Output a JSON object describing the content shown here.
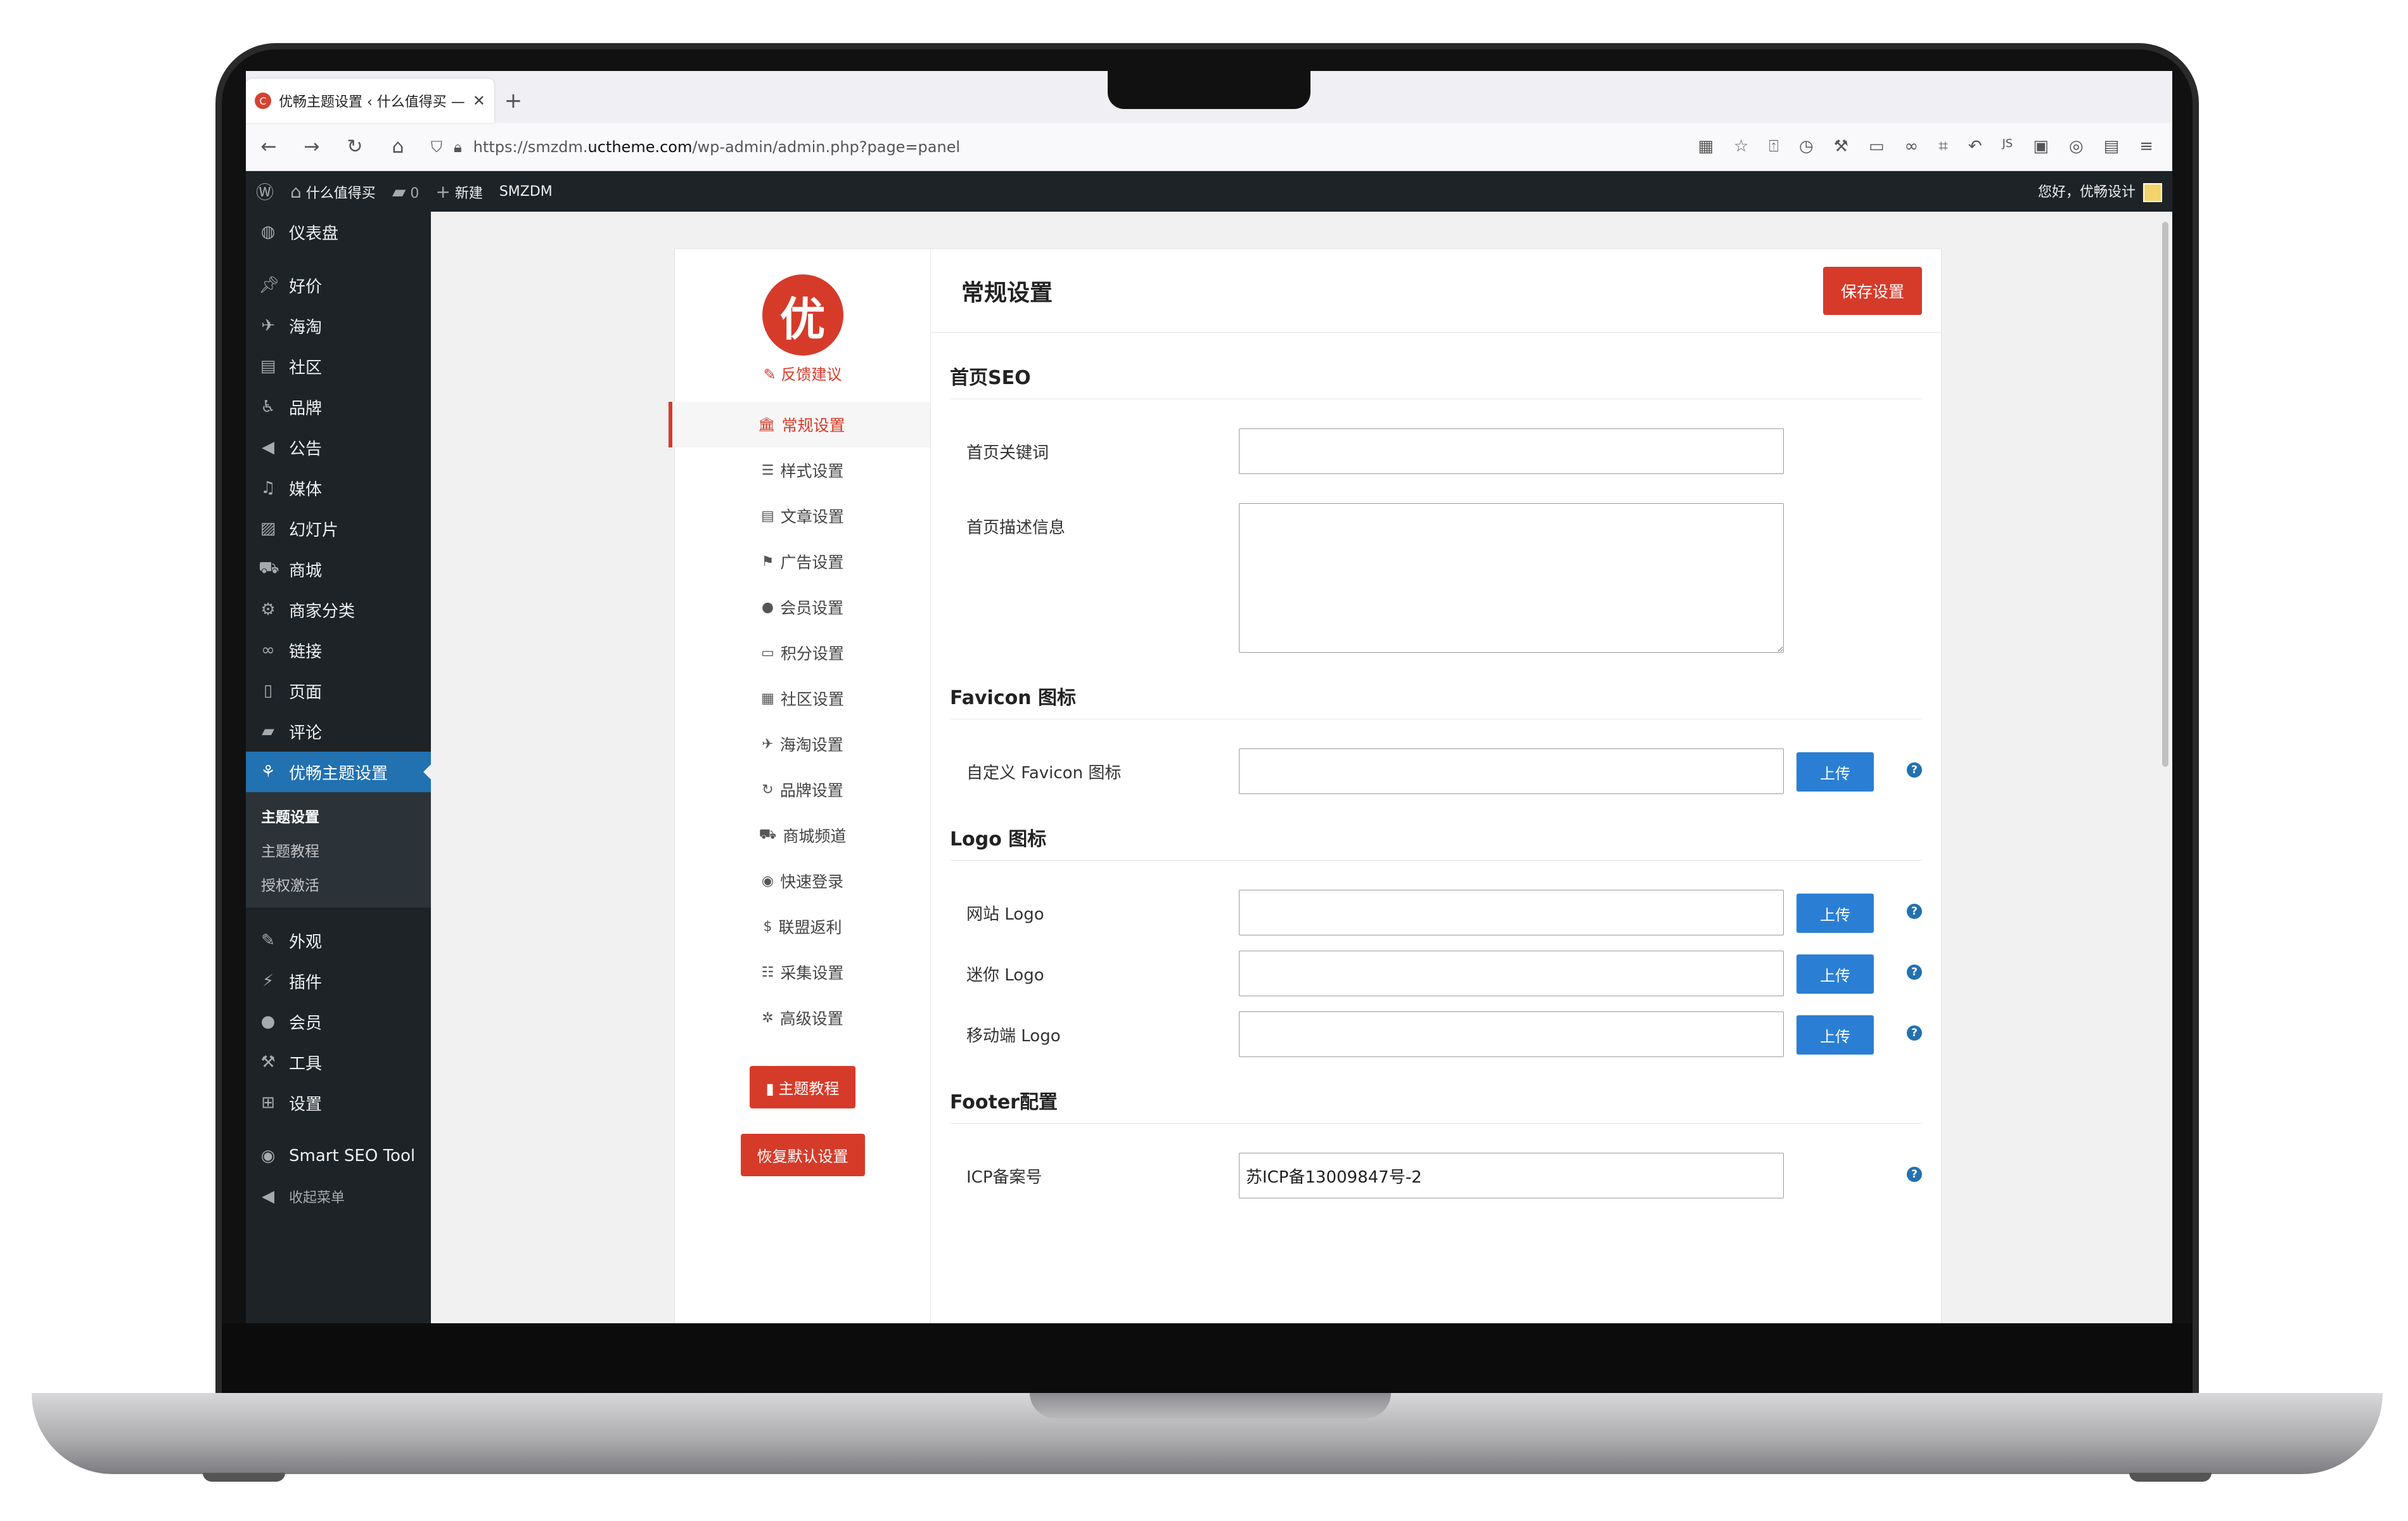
{
  "browser": {
    "tab_title": "优畅主题设置 ‹ 什么值得买 — Wo",
    "url_prefix": "https://smzdm.",
    "url_domain": "uctheme.com",
    "url_path": "/wp-admin/admin.php?page=panel",
    "new_tab": "+",
    "tab_close": "✕",
    "toolbar_icons": [
      "qr-icon",
      "star-icon",
      "save-icon",
      "history-icon",
      "wrench-icon",
      "window-icon",
      "tracking-icon",
      "crop-icon",
      "undo-icon",
      "js-icon",
      "extension-icon",
      "circle-icon",
      "reader-icon",
      "menu-icon"
    ]
  },
  "adminbar": {
    "site_name": "什么值得买",
    "comments_count": "0",
    "new_label": "新建",
    "plugin_label": "SMZDM",
    "greeting": "您好，优畅设计"
  },
  "sidebar": {
    "dashboard": "仪表盘",
    "items": [
      {
        "label": "好价",
        "icon": "pin-icon"
      },
      {
        "label": "海淘",
        "icon": "plane-icon"
      },
      {
        "label": "社区",
        "icon": "chat-icon"
      },
      {
        "label": "品牌",
        "icon": "accessibility-icon"
      },
      {
        "label": "公告",
        "icon": "megaphone-icon"
      },
      {
        "label": "媒体",
        "icon": "media-icon"
      },
      {
        "label": "幻灯片",
        "icon": "slides-icon"
      },
      {
        "label": "商城",
        "icon": "cart-icon"
      },
      {
        "label": "商家分类",
        "icon": "gear-icon"
      },
      {
        "label": "链接",
        "icon": "link-icon"
      },
      {
        "label": "页面",
        "icon": "page-icon"
      },
      {
        "label": "评论",
        "icon": "comment-icon"
      }
    ],
    "active": "优畅主题设置",
    "submenu": [
      "主题设置",
      "主题教程",
      "授权激活"
    ],
    "items2": [
      {
        "label": "外观",
        "icon": "brush-icon"
      },
      {
        "label": "插件",
        "icon": "plugin-icon"
      },
      {
        "label": "会员",
        "icon": "user-icon"
      },
      {
        "label": "工具",
        "icon": "wrench-icon"
      },
      {
        "label": "设置",
        "icon": "settings-icon"
      }
    ],
    "seo_tool": "Smart SEO Tool",
    "collapse": "收起菜单"
  },
  "optnav": {
    "logo_char": "优",
    "feedback": "反馈建议",
    "items": [
      {
        "label": "常规设置",
        "icon": "🏛"
      },
      {
        "label": "样式设置",
        "icon": "☰"
      },
      {
        "label": "文章设置",
        "icon": "▤"
      },
      {
        "label": "广告设置",
        "icon": "⚑"
      },
      {
        "label": "会员设置",
        "icon": "●"
      },
      {
        "label": "积分设置",
        "icon": "▭"
      },
      {
        "label": "社区设置",
        "icon": "▦"
      },
      {
        "label": "海淘设置",
        "icon": "✈"
      },
      {
        "label": "品牌设置",
        "icon": "↻"
      },
      {
        "label": "商城频道",
        "icon": "⛟"
      },
      {
        "label": "快速登录",
        "icon": "◉"
      },
      {
        "label": "联盟返利",
        "icon": "$"
      },
      {
        "label": "采集设置",
        "icon": "☷"
      },
      {
        "label": "高级设置",
        "icon": "✲"
      }
    ],
    "tutorial_btn": "主题教程",
    "restore_btn": "恢复默认设置"
  },
  "settings": {
    "title": "常规设置",
    "save_btn": "保存设置",
    "upload_label": "上传",
    "help_glyph": "?",
    "sections": {
      "seo": "首页SEO",
      "favicon": "Favicon 图标",
      "logo": "Logo 图标",
      "footer": "Footer配置"
    },
    "fields": {
      "keywords": {
        "label": "首页关键词",
        "value": ""
      },
      "description": {
        "label": "首页描述信息",
        "value": ""
      },
      "favicon": {
        "label": "自定义 Favicon 图标",
        "value": ""
      },
      "site_logo": {
        "label": "网站 Logo",
        "value": ""
      },
      "mini_logo": {
        "label": "迷你 Logo",
        "value": ""
      },
      "mobile_logo": {
        "label": "移动端 Logo",
        "value": ""
      },
      "icp": {
        "label": "ICP备案号",
        "value": "苏ICP备13009847号-2"
      }
    }
  }
}
